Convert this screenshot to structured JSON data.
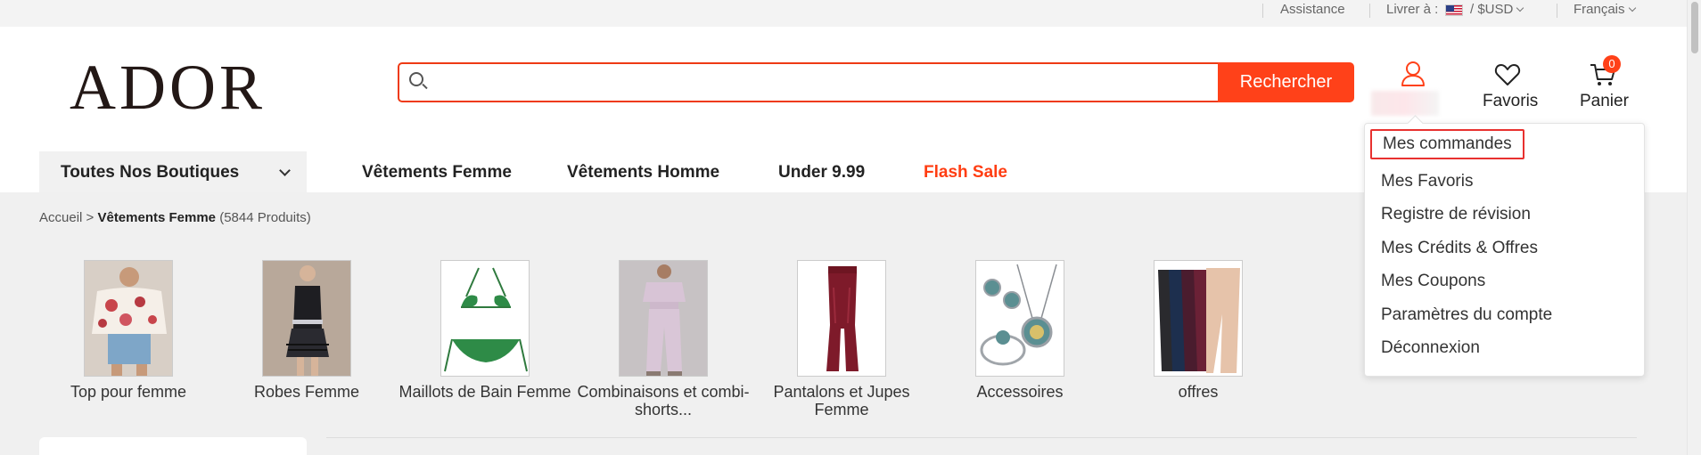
{
  "topbar": {
    "assistance": "Assistance",
    "deliver_to": "Livrer à :",
    "currency": "/ $USD",
    "language": "Français"
  },
  "header": {
    "logo": "ADOR",
    "search_placeholder": "",
    "search_button": "Rechercher",
    "favorites_label": "Favoris",
    "cart_label": "Panier",
    "cart_count": "0"
  },
  "nav": {
    "all_shops": "Toutes Nos Boutiques",
    "items": [
      "Vêtements Femme",
      "Vêtements Homme",
      "Under 9.99",
      "Flash Sale"
    ]
  },
  "breadcrumb": {
    "home": "Accueil",
    "separator": ">",
    "current": "Vêtements Femme",
    "count": "(5844 Produits)"
  },
  "categories": [
    {
      "label": "Top pour femme",
      "icon": "floral-blouse-image"
    },
    {
      "label": "Robes Femme",
      "icon": "black-dress-image"
    },
    {
      "label": "Maillots de Bain Femme",
      "icon": "green-bikini-image"
    },
    {
      "label": "Combinaisons et combi-shorts...",
      "icon": "lilac-jumpsuit-image"
    },
    {
      "label": "Pantalons et Jupes Femme",
      "icon": "burgundy-pants-image"
    },
    {
      "label": "Accessoires",
      "icon": "jewelry-set-image"
    },
    {
      "label": "offres",
      "icon": "leggings-image"
    }
  ],
  "account_menu": {
    "items": [
      "Mes commandes",
      "Mes Favoris",
      "Registre de révision",
      "Mes Crédits & Offres",
      "Mes Coupons",
      "Paramètres du compte",
      "Déconnexion"
    ],
    "highlighted_index": 0
  },
  "colors": {
    "accent": "#ff4119",
    "flash_sale": "#ff3d12",
    "highlight_border": "#e8312f"
  }
}
